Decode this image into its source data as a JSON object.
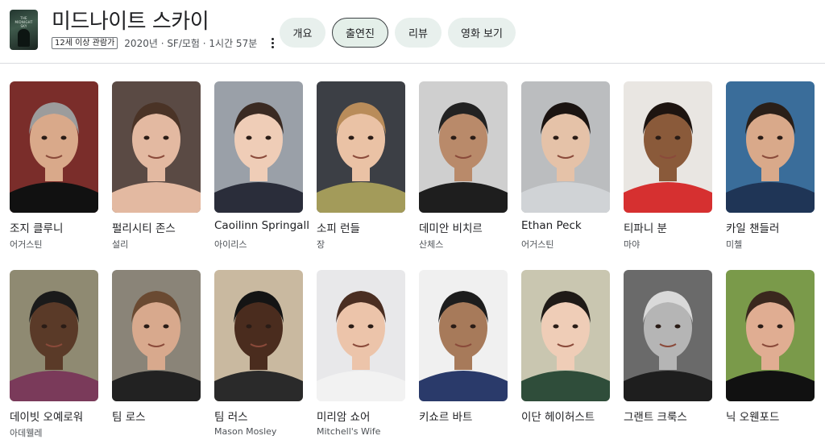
{
  "movie": {
    "title": "미드나이트 스카이",
    "rating": "12세 이상 관람가",
    "info": "2020년 · SF/모험 · 1시간 57분",
    "poster_text": "THE MIDNIGHT SKY"
  },
  "tabs": [
    {
      "label": "개요",
      "active": false
    },
    {
      "label": "출연진",
      "active": true
    },
    {
      "label": "리뷰",
      "active": false
    },
    {
      "label": "영화 보기",
      "active": false
    }
  ],
  "cast": [
    {
      "name": "조지 클루니",
      "role": "어거스틴",
      "bg": "#7a2d2a",
      "skin": "#d9a98a",
      "hair": "#9c9c9c",
      "shirt": "#111111"
    },
    {
      "name": "펄리시티 존스",
      "role": "설리",
      "bg": "#5a4a44",
      "skin": "#e3b9a1",
      "hair": "#4a3326",
      "shirt": "#e3b9a1"
    },
    {
      "name": "Caoilinn Springall",
      "role": "아이리스",
      "bg": "#9aa0a8",
      "skin": "#efcdb7",
      "hair": "#3a2a22",
      "shirt": "#2a2d3a"
    },
    {
      "name": "소피 런들",
      "role": "장",
      "bg": "#3c3f45",
      "skin": "#eac2a5",
      "hair": "#b98c5a",
      "shirt": "#a39b5a"
    },
    {
      "name": "데미안 비치르",
      "role": "산체스",
      "bg": "#cfcfcf",
      "skin": "#b98a6a",
      "hair": "#222222",
      "shirt": "#1e1e1e"
    },
    {
      "name": "Ethan Peck",
      "role": "어거스틴",
      "bg": "#bbbdbf",
      "skin": "#e5c2a8",
      "hair": "#1b1411",
      "shirt": "#d0d3d6"
    },
    {
      "name": "티파니 분",
      "role": "마야",
      "bg": "#e9e6e2",
      "skin": "#8a5a3a",
      "hair": "#1d1410",
      "shirt": "#d63030"
    },
    {
      "name": "카일 챈들러",
      "role": "미첼",
      "bg": "#3a6d9a",
      "skin": "#d9a98a",
      "hair": "#2a1f18",
      "shirt": "#1f3556"
    },
    {
      "name": "데이빗 오예로워",
      "role": "아데웰레",
      "bg": "#8f8a72",
      "skin": "#5a3a28",
      "hair": "#1a1a1a",
      "shirt": "#7a3a5a"
    },
    {
      "name": "팀 로스",
      "role": "",
      "bg": "#8a8478",
      "skin": "#d8a98d",
      "hair": "#6a4a32",
      "shirt": "#222222"
    },
    {
      "name": "팀 러스",
      "role": "Mason Mosley",
      "bg": "#c9b9a0",
      "skin": "#4a2c1e",
      "hair": "#141414",
      "shirt": "#2a2a2a"
    },
    {
      "name": "미리암 쇼어",
      "role": "Mitchell's Wife",
      "bg": "#e8e8ea",
      "skin": "#ecc4aa",
      "hair": "#4a2e22",
      "shirt": "#f2f2f2"
    },
    {
      "name": "키쇼르 바트",
      "role": "",
      "bg": "#f0f0f0",
      "skin": "#a77a5a",
      "hair": "#1d1d1d",
      "shirt": "#2a3a6a"
    },
    {
      "name": "이단 헤이허스트",
      "role": "",
      "bg": "#c9c6b0",
      "skin": "#efcdb7",
      "hair": "#1f1a17",
      "shirt": "#2f4d3a"
    },
    {
      "name": "그랜트 크룩스",
      "role": "",
      "bg": "#6a6a6a",
      "skin": "#b5b5b5",
      "hair": "#d9d9d9",
      "shirt": "#1e1e1e"
    },
    {
      "name": "닉 오웬포드",
      "role": "",
      "bg": "#7a9a4a",
      "skin": "#e0ad92",
      "hair": "#3a281e",
      "shirt": "#111111"
    }
  ]
}
